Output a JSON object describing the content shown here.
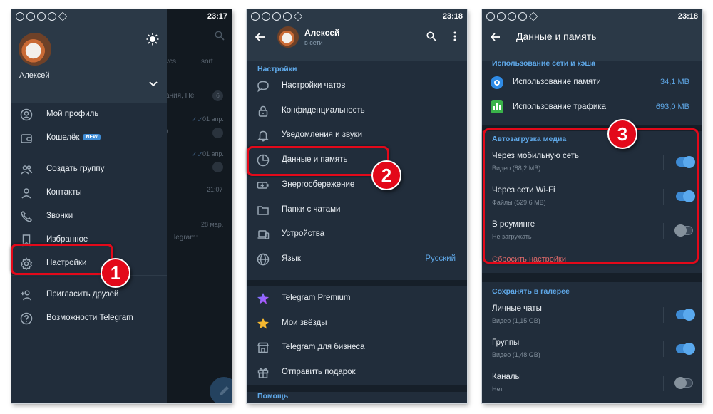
{
  "screen1": {
    "status_time": "23:17",
    "user_name": "Алексей",
    "menu": {
      "profile": "Мой профиль",
      "wallet": "Кошелёк",
      "wallet_badge": "NEW",
      "create_group": "Создать группу",
      "contacts": "Контакты",
      "calls": "Звонки",
      "favorites": "Избранное",
      "settings": "Настройки",
      "invite": "Пригласить друзей",
      "features": "Возможности Telegram"
    },
    "background": {
      "tab1": "vcs",
      "tab2": "sort",
      "chat1_snippet": "ания, Пе",
      "chat1_badge": "6",
      "chat2_date": "01 апр.",
      "chat2_snippet": ")",
      "chat3_date": "01 апр.",
      "chat4_time": "21:07",
      "chat5_date": "28 мар.",
      "chat5_snippet": "legram:"
    },
    "step_badge": "1"
  },
  "screen2": {
    "status_time": "23:18",
    "user_name": "Алексей",
    "user_status": "в сети",
    "section_settings": "Настройки",
    "items": {
      "chat_settings": "Настройки чатов",
      "privacy": "Конфиденциальность",
      "notifications": "Уведомления и звуки",
      "data_storage": "Данные и память",
      "power_saving": "Энергосбережение",
      "chat_folders": "Папки с чатами",
      "devices": "Устройства",
      "language": "Язык",
      "language_value": "Русский",
      "premium": "Telegram Premium",
      "stars": "Мои звёзды",
      "business": "Telegram для бизнеса",
      "gift": "Отправить подарок"
    },
    "section_help": "Помощь",
    "step_badge": "2"
  },
  "screen3": {
    "status_time": "23:18",
    "title": "Данные и память",
    "section_network": "Использование сети и кэша",
    "storage_usage": "Использование памяти",
    "storage_value": "34,1 MB",
    "traffic_usage": "Использование трафика",
    "traffic_value": "693,0 MB",
    "section_autodownload": "Автозагрузка медиа",
    "mobile": "Через мобильную сеть",
    "mobile_sub": "Видео (88,2 MB)",
    "mobile_on": true,
    "wifi": "Через сети Wi-Fi",
    "wifi_sub": "Файлы (529,6 MB)",
    "wifi_on": true,
    "roaming": "В роуминге",
    "roaming_sub": "Не загружать",
    "roaming_on": false,
    "reset": "Сбросить настройки",
    "section_gallery": "Сохранять в галерее",
    "private_chats": "Личные чаты",
    "private_sub": "Видео (1,15 GB)",
    "private_on": true,
    "groups": "Группы",
    "groups_sub": "Видео (1,48 GB)",
    "groups_on": true,
    "channels": "Каналы",
    "channels_sub": "Нет",
    "channels_on": false,
    "step_badge": "3"
  },
  "colors": {
    "accent": "#3e8bd4",
    "highlight": "#e3091a",
    "panel": "#212d3b",
    "storage_icon": "#2f8be6",
    "traffic_icon": "#3ab34a"
  }
}
